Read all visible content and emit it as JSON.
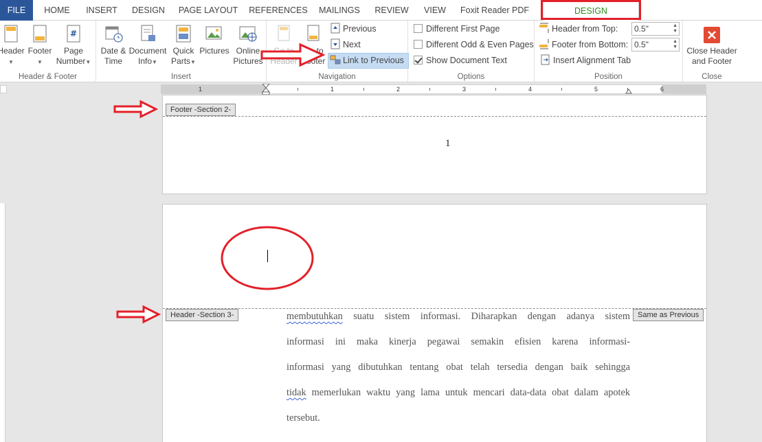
{
  "tabs": [
    {
      "label": "FILE"
    },
    {
      "label": "HOME"
    },
    {
      "label": "INSERT"
    },
    {
      "label": "DESIGN"
    },
    {
      "label": "PAGE LAYOUT"
    },
    {
      "label": "REFERENCES"
    },
    {
      "label": "MAILINGS"
    },
    {
      "label": "REVIEW"
    },
    {
      "label": "VIEW"
    },
    {
      "label": "Foxit Reader PDF"
    },
    {
      "label": "DESIGN"
    }
  ],
  "groups": {
    "header_footer": {
      "label": "Header & Footer",
      "header": "Header",
      "footer": "Footer",
      "page_number_1": "Page",
      "page_number_2": "Number"
    },
    "insert": {
      "label": "Insert",
      "date_1": "Date &",
      "date_2": "Time",
      "docinfo_1": "Document",
      "docinfo_2": "Info",
      "quick_1": "Quick",
      "quick_2": "Parts",
      "pictures": "Pictures",
      "online_1": "Online",
      "online_2": "Pictures"
    },
    "navigation": {
      "label": "Navigation",
      "goto_header_1": "Go to",
      "goto_header_2": "Header",
      "goto_footer_1": "Go to",
      "goto_footer_2": "Footer",
      "previous": "Previous",
      "next": "Next",
      "link_previous": "Link to Previous"
    },
    "options": {
      "label": "Options",
      "diff_first": "Different First Page",
      "diff_odd_even": "Different Odd & Even Pages",
      "show_doc_text": "Show Document Text",
      "diff_first_checked": false,
      "diff_odd_even_checked": false,
      "show_doc_text_checked": true
    },
    "position": {
      "label": "Position",
      "header_from_top": "Header from Top:",
      "header_from_top_value": "0.5\"",
      "footer_from_bottom": "Footer from Bottom:",
      "footer_from_bottom_value": "0.5\"",
      "insert_alignment_tab": "Insert Alignment Tab"
    },
    "close": {
      "label": "Close",
      "close_1": "Close Header",
      "close_2": "and Footer"
    }
  },
  "ruler": {
    "numbers": [
      "1",
      "1",
      "2",
      "3",
      "4",
      "5",
      "6"
    ]
  },
  "document": {
    "footer_label": "Footer -Section 2-",
    "page_number": "1",
    "header_label": "Header -Section 3-",
    "same_as_previous": "Same as Previous",
    "lines": [
      {
        "pre": "",
        "squig": "membutuhkan",
        "post": " suatu sistem informasi. Diharapkan dengan adanya sistem"
      },
      {
        "pre": "informasi ini maka kinerja pegawai semakin efisien karena informasi-",
        "squig": "",
        "post": ""
      },
      {
        "pre": "informasi yang dibutuhkan tentang obat telah tersedia dengan baik sehingga",
        "squig": "",
        "post": ""
      },
      {
        "pre": "",
        "squig": "tidak",
        "post": " memerlukan waktu yang lama untuk mencari data-data obat dalam apotek"
      },
      {
        "pre": "tersebut.",
        "squig": "",
        "post": ""
      }
    ]
  },
  "colors": {
    "file_tab": "#2b579a",
    "active_tab_text": "#2e8b20",
    "annotation_red": "#e3202a",
    "link_previous_highlight": "#c5dcf3",
    "close_icon": "#e34a33"
  }
}
